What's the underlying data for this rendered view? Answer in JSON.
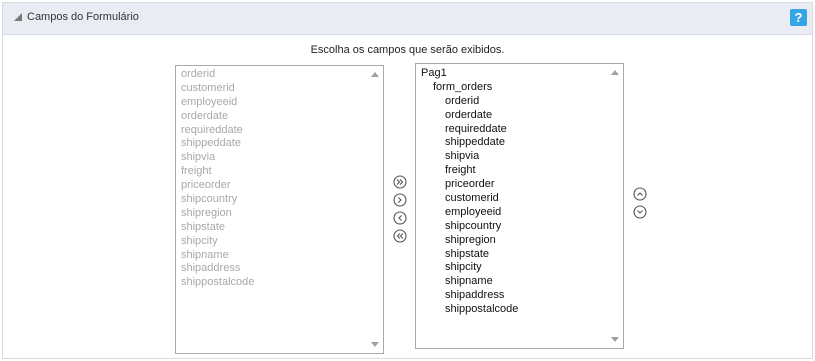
{
  "header": {
    "title": "Campos do Formulário",
    "help_label": "?"
  },
  "instruction": "Escolha os campos que serão exibidos.",
  "available_fields": [
    "orderid",
    "customerid",
    "employeeid",
    "orderdate",
    "requireddate",
    "shippeddate",
    "shipvia",
    "freight",
    "priceorder",
    "shipcountry",
    "shipregion",
    "shipstate",
    "shipcity",
    "shipname",
    "shipaddress",
    "shippostalcode"
  ],
  "selected_tree": {
    "page": "Pag1",
    "block": "form_orders",
    "fields": [
      "orderid",
      "orderdate",
      "requireddate",
      "shippeddate",
      "shipvia",
      "freight",
      "priceorder",
      "customerid",
      "employeeid",
      "shipcountry",
      "shipregion",
      "shipstate",
      "shipcity",
      "shipname",
      "shipaddress",
      "shippostalcode"
    ]
  },
  "icons": {
    "move_all_right": "double-chevron-right-icon",
    "move_right": "chevron-right-icon",
    "move_left": "chevron-left-icon",
    "move_all_left": "double-chevron-left-icon",
    "move_up": "chevron-up-icon",
    "move_down": "chevron-down-icon"
  },
  "colors": {
    "header_bg": "#e9edf3",
    "help_accent": "#35a5e6",
    "disabled_text": "#a8a8a8"
  }
}
